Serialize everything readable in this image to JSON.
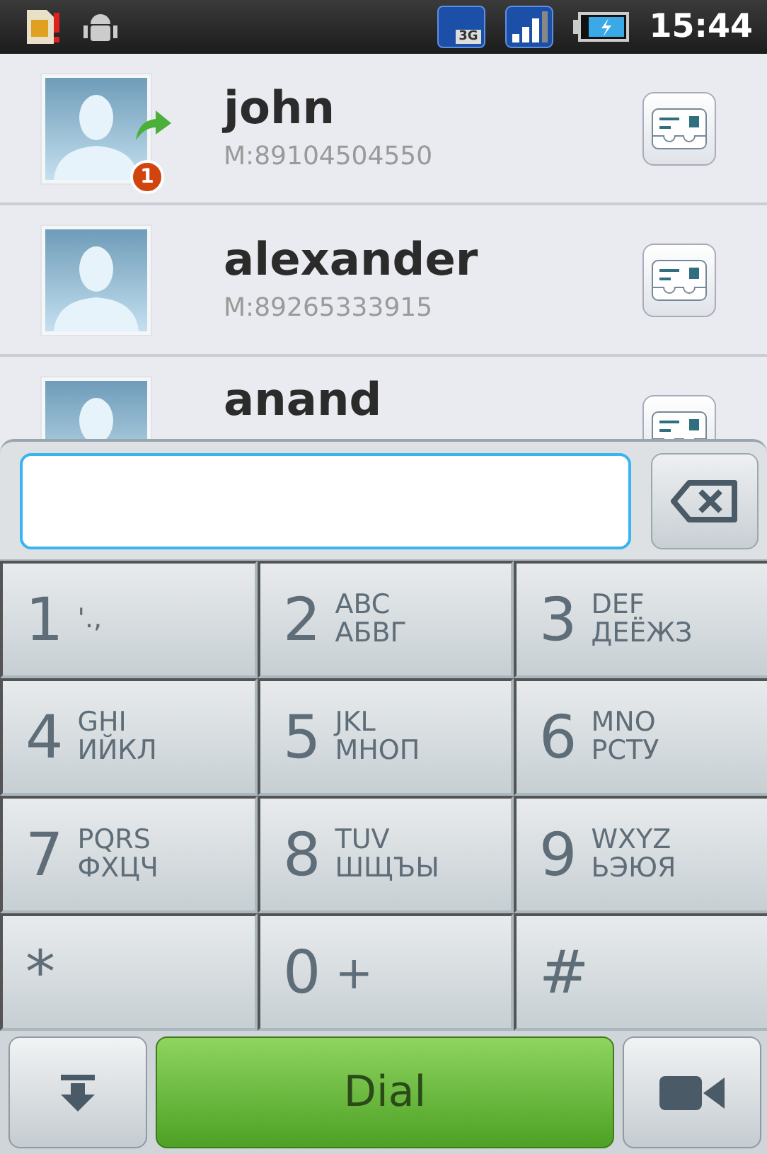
{
  "status_bar": {
    "network": "3G",
    "time": "15:44"
  },
  "contacts": [
    {
      "name": "john",
      "number": "M:89104504550",
      "missed_badge": "1"
    },
    {
      "name": "alexander",
      "number": "M:89265333915"
    },
    {
      "name": "anand"
    }
  ],
  "keys": [
    {
      "digit": "1",
      "latin": "'.,"
    },
    {
      "digit": "2",
      "latin": "ABC",
      "cyrillic": "АБВГ"
    },
    {
      "digit": "3",
      "latin": "DEF",
      "cyrillic": "ДЕЁЖЗ"
    },
    {
      "digit": "4",
      "latin": "GHI",
      "cyrillic": "ИЙКЛ"
    },
    {
      "digit": "5",
      "latin": "JKL",
      "cyrillic": "МНОП"
    },
    {
      "digit": "6",
      "latin": "MNO",
      "cyrillic": "РСТУ"
    },
    {
      "digit": "7",
      "latin": "PQRS",
      "cyrillic": "ФХЦЧ"
    },
    {
      "digit": "8",
      "latin": "TUV",
      "cyrillic": "ШЩЪЫ"
    },
    {
      "digit": "9",
      "latin": "WXYZ",
      "cyrillic": "ЬЭЮЯ"
    },
    {
      "digit": "*"
    },
    {
      "digit": "0",
      "latin": "+"
    },
    {
      "digit": "#"
    }
  ],
  "dial_button": {
    "label": "Dial"
  }
}
